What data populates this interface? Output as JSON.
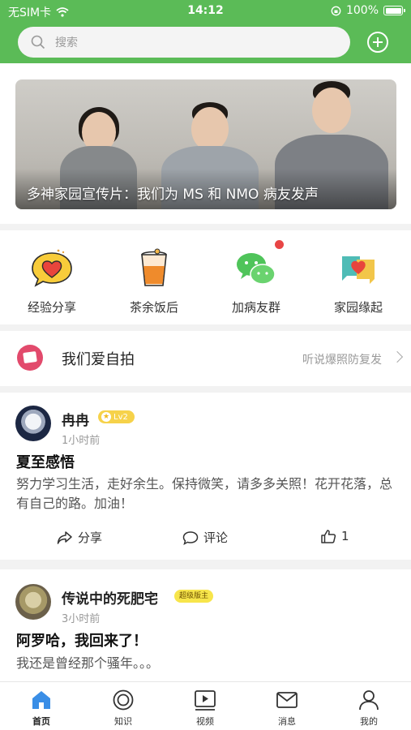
{
  "status": {
    "carrier": "无SIM卡",
    "time": "14:12",
    "battery": "100%"
  },
  "header": {
    "search_placeholder": "搜索"
  },
  "banner": {
    "caption": "多神家园宣传片：我们为 MS 和 NMO 病友发声"
  },
  "quick_entries": [
    {
      "label": "经验分享",
      "icon": "heart-chat-icon"
    },
    {
      "label": "茶余饭后",
      "icon": "drink-cup-icon"
    },
    {
      "label": "加病友群",
      "icon": "wechat-icon"
    },
    {
      "label": "家园缘起",
      "icon": "heart-bubbles-icon"
    }
  ],
  "selfie": {
    "title": "我们爱自拍",
    "subtitle": "听说爆照防复发"
  },
  "posts": [
    {
      "user": "冉冉",
      "level": "Lv2",
      "time": "1小时前",
      "title": "夏至感悟",
      "body": "努力学习生活，走好余生。保持微笑，请多多关照！花开花落，总有自己的路。加油！",
      "share_label": "分享",
      "comment_label": "评论",
      "like_count": "1"
    },
    {
      "user": "传说中的死肥宅",
      "badge": "超级版主",
      "time": "3小时前",
      "title": "阿罗哈，我回来了！",
      "body": "我还是曾经那个骚年。。。"
    }
  ],
  "tabs": [
    {
      "label": "首页",
      "icon": "home-icon"
    },
    {
      "label": "知识",
      "icon": "knowledge-icon"
    },
    {
      "label": "视频",
      "icon": "video-icon"
    },
    {
      "label": "消息",
      "icon": "message-icon"
    },
    {
      "label": "我的",
      "icon": "profile-icon"
    }
  ],
  "colors": {
    "brand": "#5bbb57",
    "tab_active": "#3a8ee6"
  }
}
